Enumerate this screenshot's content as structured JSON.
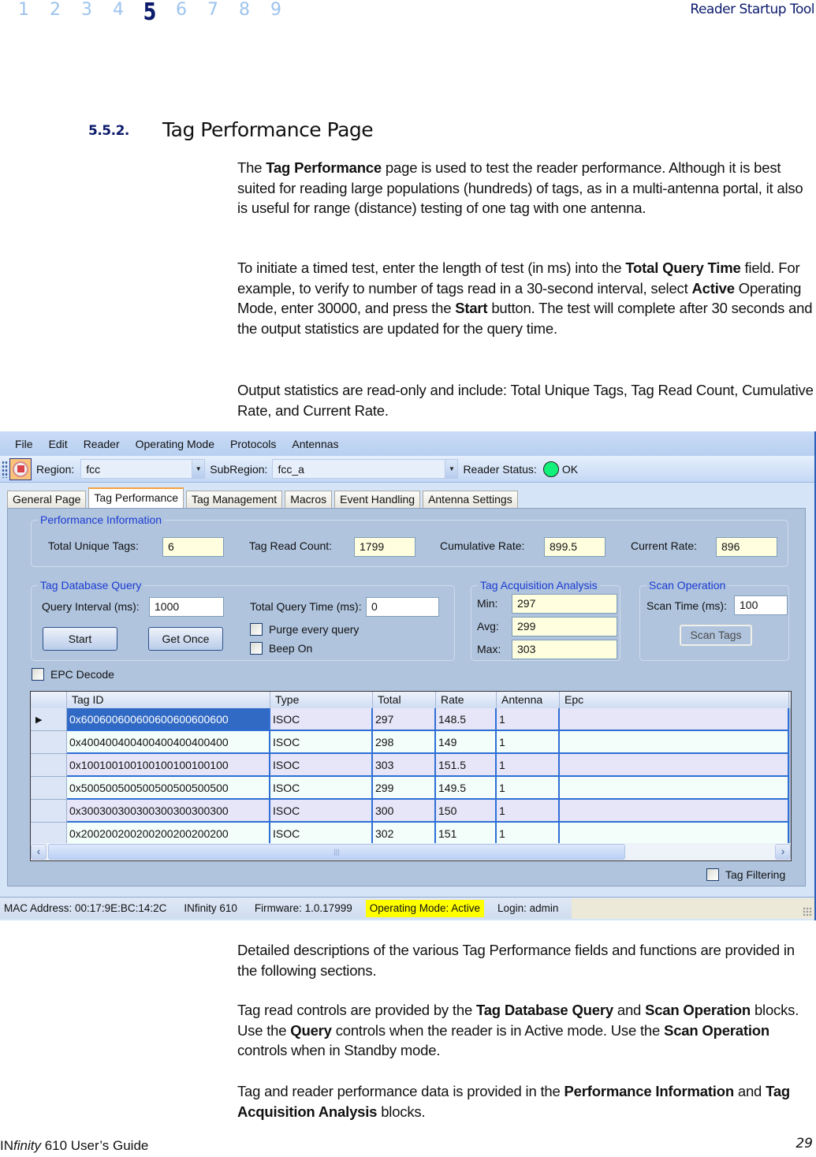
{
  "header": {
    "chapters": [
      "1",
      "2",
      "3",
      "4",
      "5",
      "6",
      "7",
      "8",
      "9"
    ],
    "current_chapter": "5",
    "running_head": "Reader Startup Tool"
  },
  "section": {
    "number": "5.5.2.",
    "title": "Tag Performance Page"
  },
  "intro": {
    "p1": [
      {
        "t": "The ",
        "b": false
      },
      {
        "t": "Tag Performance",
        "b": true
      },
      {
        "t": " page is used to test the reader performance. Although it is best suited for reading large populations (hundreds) of tags, as in a multi-antenna portal, it also is useful for range (distance) testing of one tag with one antenna.",
        "b": false
      }
    ],
    "p2": [
      {
        "t": "To initiate a timed test, enter the length of test (in ms) into the ",
        "b": false
      },
      {
        "t": "Total Query Time",
        "b": true
      },
      {
        "t": " field. For example, to verify to number of tags read in a 30-second interval, select ",
        "b": false
      },
      {
        "t": "Active",
        "b": true
      },
      {
        "t": " Operating Mode, enter 30000, and press the ",
        "b": false
      },
      {
        "t": "Start",
        "b": true
      },
      {
        "t": " button. The test will complete after 30 seconds and the output statistics are updated for the query time.",
        "b": false
      }
    ],
    "p3": [
      {
        "t": "Output statistics are read-only and include: Total Unique Tags, Tag Read Count, Cumulative Rate, and Current Rate.",
        "b": false
      }
    ]
  },
  "app": {
    "menu": [
      "File",
      "Edit",
      "Reader",
      "Operating Mode",
      "Protocols",
      "Antennas"
    ],
    "toolbar": {
      "region_label": "Region:",
      "region_value": "fcc",
      "subregion_label": "SubRegion:",
      "subregion_value": "fcc_a",
      "status_label": "Reader Status:",
      "status_value": "OK",
      "status_color": "#12f27a"
    },
    "tabs": [
      "General Page",
      "Tag Performance",
      "Tag Management",
      "Macros",
      "Event Handling",
      "Antenna Settings"
    ],
    "active_tab": "Tag Performance",
    "performance": {
      "title": "Performance Information",
      "total_unique_tags_label": "Total Unique Tags:",
      "total_unique_tags": "6",
      "tag_read_count_label": "Tag Read Count:",
      "tag_read_count": "1799",
      "cumulative_rate_label": "Cumulative Rate:",
      "cumulative_rate": "899.5",
      "current_rate_label": "Current Rate:",
      "current_rate": "896"
    },
    "query": {
      "title": "Tag Database Query",
      "interval_label": "Query Interval (ms):",
      "interval_value": "1000",
      "total_time_label": "Total Query Time (ms):",
      "total_time_value": "0",
      "start_label": "Start",
      "get_once_label": "Get Once",
      "purge_label": "Purge every query",
      "beep_label": "Beep On"
    },
    "acquisition": {
      "title": "Tag Acquisition Analysis",
      "min_label": "Min:",
      "min": "297",
      "avg_label": "Avg:",
      "avg": "299",
      "max_label": "Max:",
      "max": "303"
    },
    "scan": {
      "title": "Scan Operation",
      "time_label": "Scan Time (ms):",
      "time_value": "100",
      "button_label": "Scan Tags"
    },
    "epc_decode_label": "EPC Decode",
    "grid": {
      "columns": [
        "Tag ID",
        "Type",
        "Total",
        "Rate",
        "Antenna",
        "Epc"
      ],
      "rows": [
        {
          "tag_id": "0x600600600600600600600600",
          "type": "ISOC",
          "total": "297",
          "rate": "148.5",
          "antenna": "1",
          "epc": ""
        },
        {
          "tag_id": "0x400400400400400400400400",
          "type": "ISOC",
          "total": "298",
          "rate": "149",
          "antenna": "1",
          "epc": ""
        },
        {
          "tag_id": "0x100100100100100100100100",
          "type": "ISOC",
          "total": "303",
          "rate": "151.5",
          "antenna": "1",
          "epc": ""
        },
        {
          "tag_id": "0x500500500500500500500500",
          "type": "ISOC",
          "total": "299",
          "rate": "149.5",
          "antenna": "1",
          "epc": ""
        },
        {
          "tag_id": "0x300300300300300300300300",
          "type": "ISOC",
          "total": "300",
          "rate": "150",
          "antenna": "1",
          "epc": ""
        },
        {
          "tag_id": "0x200200200200200200200200",
          "type": "ISOC",
          "total": "302",
          "rate": "151",
          "antenna": "1",
          "epc": ""
        }
      ],
      "current_row_marker": "▶",
      "scroll_left": "‹",
      "scroll_right": "›",
      "scroll_thumb_grip": "|||"
    },
    "tag_filtering_label": "Tag Filtering",
    "statusbar": {
      "mac": "MAC Address: 00:17:9E:BC:14:2C",
      "model": "INfinity 610",
      "firmware": "Firmware: 1.0.17999",
      "mode": "Operating Mode: Active",
      "login": "Login: admin",
      "mode_highlight_color": "#ffff00"
    }
  },
  "after": {
    "p4": [
      {
        "t": "Detailed descriptions of the various Tag Performance fields and functions are provided in the following sections.",
        "b": false
      }
    ],
    "p5": [
      {
        "t": "Tag read controls are provided by the ",
        "b": false
      },
      {
        "t": "Tag Database Query",
        "b": true
      },
      {
        "t": " and ",
        "b": false
      },
      {
        "t": "Scan Operation",
        "b": true
      },
      {
        "t": " blocks. Use the ",
        "b": false
      },
      {
        "t": "Query",
        "b": true
      },
      {
        "t": " controls when the reader is in Active mode. Use the ",
        "b": false
      },
      {
        "t": "Scan Operation",
        "b": true
      },
      {
        "t": " controls when in Standby mode.",
        "b": false
      }
    ],
    "p6": [
      {
        "t": "Tag and reader performance data is provided in the ",
        "b": false
      },
      {
        "t": "Performance Information",
        "b": true
      },
      {
        "t": " and ",
        "b": false
      },
      {
        "t": "Tag Acquisition Analysis",
        "b": true
      },
      {
        "t": " blocks.",
        "b": false
      }
    ]
  },
  "footer": {
    "guide_prefix": "IN",
    "guide_italic": "finity",
    "guide_suffix": " 610 User’s Guide",
    "page_number": "29"
  }
}
